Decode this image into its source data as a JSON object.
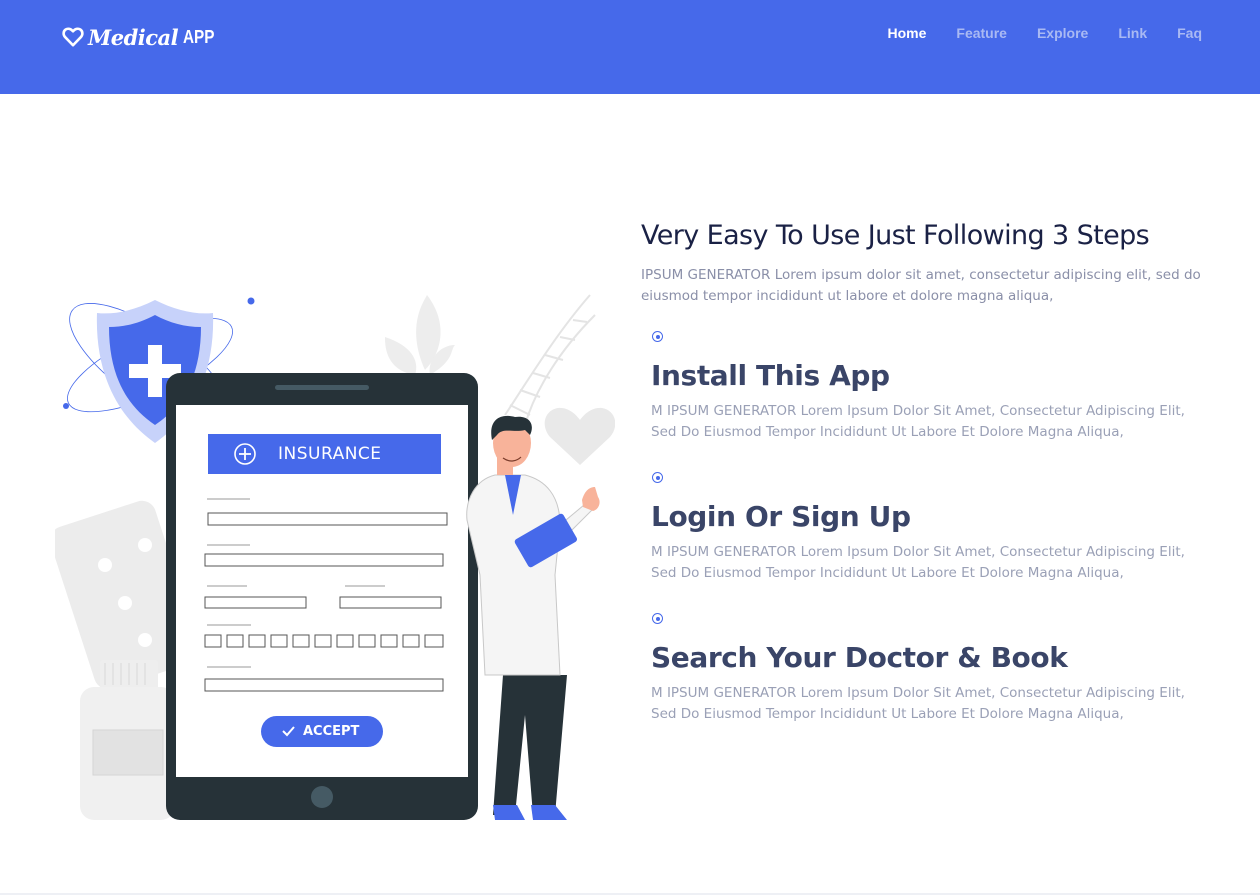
{
  "header": {
    "logo": {
      "icon": "heart-outline-icon",
      "brand": "Medical",
      "brand_suffix": "APP"
    },
    "nav": [
      {
        "label": "Home",
        "active": true
      },
      {
        "label": "Feature",
        "active": false
      },
      {
        "label": "Explore",
        "active": false
      },
      {
        "label": "Link",
        "active": false
      },
      {
        "label": "Faq",
        "active": false
      }
    ]
  },
  "illustration": {
    "card_title": "INSURANCE",
    "accept_label": "ACCEPT"
  },
  "main": {
    "title": "Very Easy To Use Just Following 3 Steps",
    "description": "IPSUM GENERATOR Lorem ipsum dolor sit amet, consectetur adipiscing elit, sed do eiusmod tempor incididunt ut labore et dolore magna aliqua,",
    "steps": [
      {
        "title": "Install This App",
        "description": "M IPSUM GENERATOR Lorem Ipsum Dolor Sit Amet, Consectetur Adipiscing Elit, Sed Do Eiusmod Tempor Incididunt Ut Labore Et Dolore Magna Aliqua,"
      },
      {
        "title": "Login Or Sign Up",
        "description": "M IPSUM GENERATOR Lorem Ipsum Dolor Sit Amet, Consectetur Adipiscing Elit, Sed Do Eiusmod Tempor Incididunt Ut Labore Et Dolore Magna Aliqua,"
      },
      {
        "title": "Search Your Doctor & Book",
        "description": "M IPSUM GENERATOR Lorem Ipsum Dolor Sit Amet, Consectetur Adipiscing Elit, Sed Do Eiusmod Tempor Incididunt Ut Labore Et Dolore Magna Aliqua,"
      }
    ]
  },
  "colors": {
    "brand": "#4669ea",
    "heading": "#1a2145",
    "step_heading": "#3a4568",
    "body_text": "#8a8fa8"
  }
}
